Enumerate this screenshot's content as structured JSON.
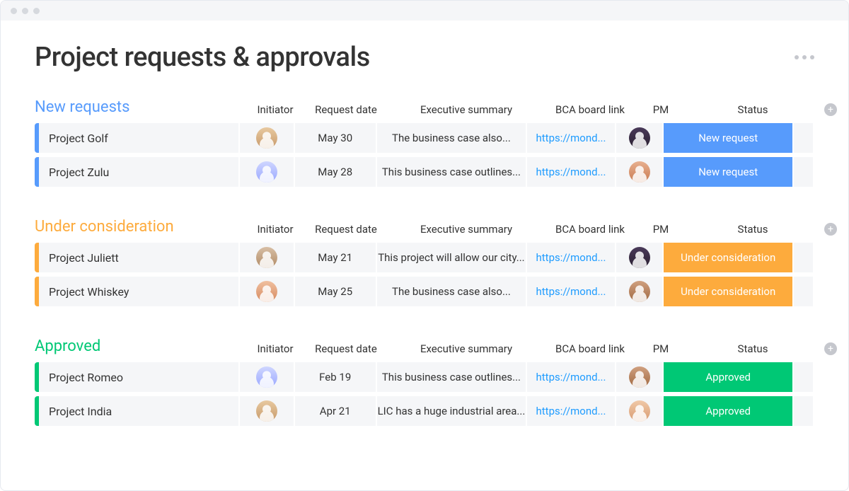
{
  "page": {
    "title": "Project requests & approvals"
  },
  "columns": {
    "initiator": "Initiator",
    "request_date": "Request date",
    "summary": "Executive summary",
    "bca_link": "BCA board link",
    "pm": "PM",
    "status": "Status"
  },
  "groups": [
    {
      "id": "new",
      "title": "New requests",
      "color_class": "blue",
      "rows": [
        {
          "name": "Project Golf",
          "initiator_avatar": "av1",
          "date": "May 30",
          "summary": "The business case also...",
          "link": "https://mond...",
          "pm_avatar": "av5",
          "status_label": "New request"
        },
        {
          "name": "Project Zulu",
          "initiator_avatar": "av2",
          "date": "May 28",
          "summary": "This business case outlines...",
          "link": "https://mond...",
          "pm_avatar": "av6",
          "status_label": "New request"
        }
      ]
    },
    {
      "id": "under",
      "title": "Under consideration",
      "color_class": "orange",
      "rows": [
        {
          "name": "Project Juliett",
          "initiator_avatar": "av3",
          "date": "May 21",
          "summary": "This project will allow our city...",
          "link": "https://mond...",
          "pm_avatar": "av5",
          "status_label": "Under consideration"
        },
        {
          "name": "Project Whiskey",
          "initiator_avatar": "av4",
          "date": "May 25",
          "summary": "The business case also...",
          "link": "https://mond...",
          "pm_avatar": "av7",
          "status_label": "Under consideration"
        }
      ]
    },
    {
      "id": "approved",
      "title": "Approved",
      "color_class": "green",
      "rows": [
        {
          "name": "Project Romeo",
          "initiator_avatar": "av2",
          "date": "Feb 19",
          "summary": "This business case outlines...",
          "link": "https://mond...",
          "pm_avatar": "av7",
          "status_label": "Approved"
        },
        {
          "name": "Project India",
          "initiator_avatar": "av1",
          "date": "Apr 21",
          "summary": "LIC has a huge industrial area...",
          "link": "https://mond...",
          "pm_avatar": "av8",
          "status_label": "Approved"
        }
      ]
    }
  ]
}
